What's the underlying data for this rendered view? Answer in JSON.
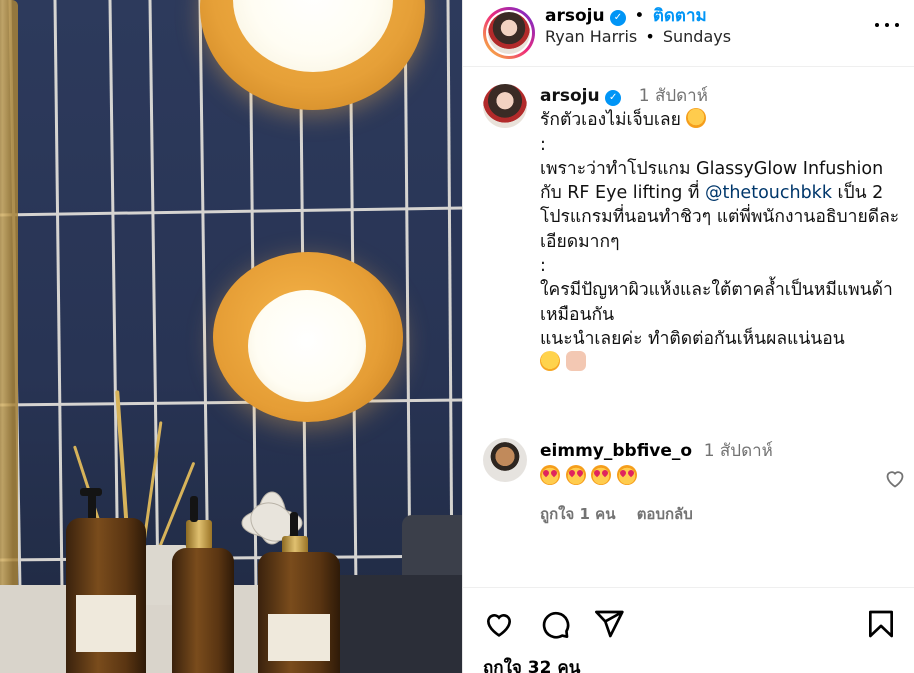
{
  "post": {
    "username": "arsoju",
    "follow_label": "ติดตาม",
    "audio_artist": "Ryan Harris",
    "audio_title": "Sundays",
    "dot": "•"
  },
  "caption": {
    "username": "arsoju",
    "time": "1 สัปดาห์",
    "line1": "รักตัวเองไม่เจ็บเลย",
    "sep1": ":",
    "line2a": "เพราะว่าทำโปรแกม GlassyGlow Infushion กับ RF Eye lifting ที่",
    "mention": "@thetouchbkk",
    "line2b": "เป็น 2 โปรแกรมที่นอนทำชิวๆ แต่พี่พนักงานอธิบายดีละเอียดมากๆ",
    "sep2": ":",
    "line3": "ใครมีปัญหาผิวแห้งและใต้ตาคล้ำเป็นหมีแพนด้าเหมือนกัน",
    "line4": "แนะนำเลยค่ะ ทำติดต่อกันเห็นผลแน่นอน"
  },
  "comment": {
    "username": "eimmy_bbfive_o",
    "time": "1 สัปดาห์",
    "likes": "ถูกใจ 1 คน",
    "reply": "ตอบกลับ"
  },
  "footer": {
    "likes": "ถูกใจ 32 คน"
  },
  "colors": {
    "link": "#0095f6",
    "mention": "#00376b",
    "muted": "#737373"
  },
  "icons": [
    "verified-icon",
    "more-options-icon",
    "heart-icon",
    "comment-icon",
    "share-icon",
    "bookmark-icon"
  ]
}
